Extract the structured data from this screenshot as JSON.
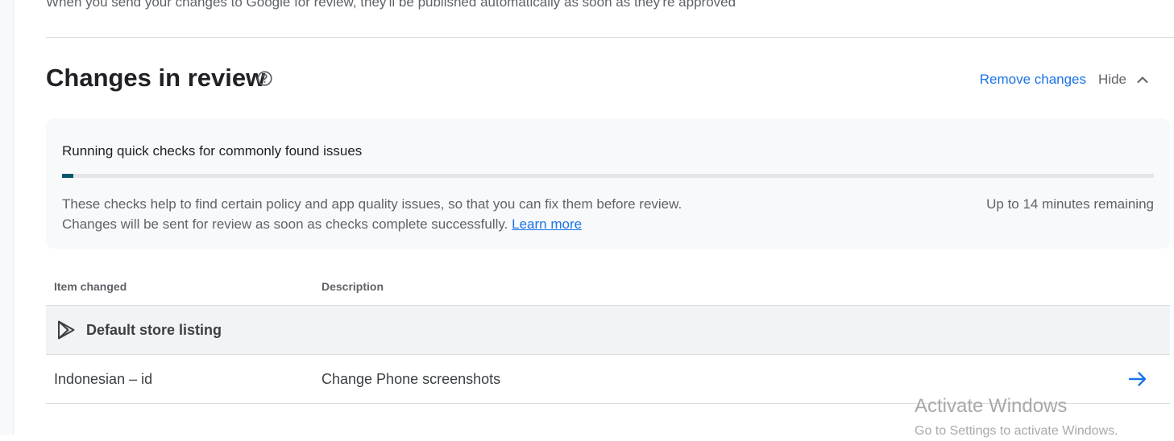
{
  "intro": {
    "text": "When you send your changes to Google for review, they'll be published automatically as soon as they're approved"
  },
  "section": {
    "title": "Changes in review",
    "help_icon": "help-circle-icon",
    "remove_changes_label": "Remove changes",
    "hide_label": "Hide",
    "hide_icon": "chevron-up-icon"
  },
  "checks": {
    "title": "Running quick checks for commonly found issues",
    "progress_fraction": 0.01,
    "progress_color": "#00566b",
    "description_line1": "These checks help to find certain policy and app quality issues, so that you can fix them before review.",
    "description_line2": "Changes will be sent for review as soon as checks complete successfully.",
    "learn_more_label": "Learn more",
    "remaining": "Up to 14 minutes remaining"
  },
  "table": {
    "columns": [
      "Item changed",
      "Description"
    ],
    "group": {
      "label": "Default store listing",
      "icon": "play-store-icon"
    },
    "rows": [
      {
        "item": "Indonesian – id",
        "description": "Change Phone screenshots",
        "action_icon": "arrow-right-icon"
      }
    ]
  },
  "watermark": {
    "line1": "Activate Windows",
    "line2": "Go to Settings to activate Windows."
  },
  "colors": {
    "accent": "#1a73e8",
    "panel_bg": "#f8f9fa",
    "group_bg": "#f1f3f4"
  }
}
